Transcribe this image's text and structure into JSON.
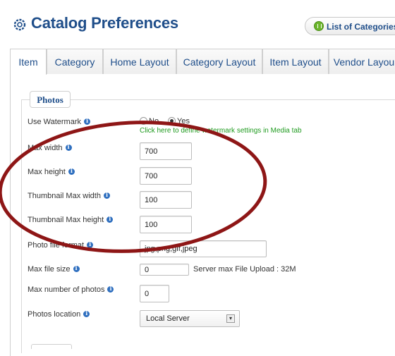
{
  "header": {
    "title": "Catalog Preferences",
    "list_button_label": "List of Categories"
  },
  "tabs": [
    {
      "label": "Item",
      "active": true
    },
    {
      "label": "Category",
      "active": false
    },
    {
      "label": "Home Layout",
      "active": false
    },
    {
      "label": "Category Layout",
      "active": false
    },
    {
      "label": "Item Layout",
      "active": false
    },
    {
      "label": "Vendor Layou",
      "active": false
    }
  ],
  "section": {
    "legend": "Photos"
  },
  "fields": {
    "use_watermark": {
      "label": "Use Watermark",
      "no": "No",
      "yes": "Yes",
      "selected": "Yes",
      "link": "Click here to define watermark settings in Media tab"
    },
    "max_width": {
      "label": "Max width",
      "value": "700"
    },
    "max_height": {
      "label": "Max height",
      "value": "700"
    },
    "thumb_max_width": {
      "label": "Thumbnail Max width",
      "value": "100"
    },
    "thumb_max_height": {
      "label": "Thumbnail Max height",
      "value": "100"
    },
    "photo_format": {
      "label": "Photo file format",
      "value": "jpg,png,gif,jpeg"
    },
    "max_file_size": {
      "label": "Max file size",
      "value": "0",
      "note": "Server max File Upload : 32M"
    },
    "max_photos": {
      "label": "Max number of photos",
      "value": "0"
    },
    "photos_location": {
      "label": "Photos location",
      "value": "Local Server"
    }
  },
  "colors": {
    "title": "#1f4e8a",
    "link": "#1e9a1e",
    "callout": "#9b1c1c"
  }
}
